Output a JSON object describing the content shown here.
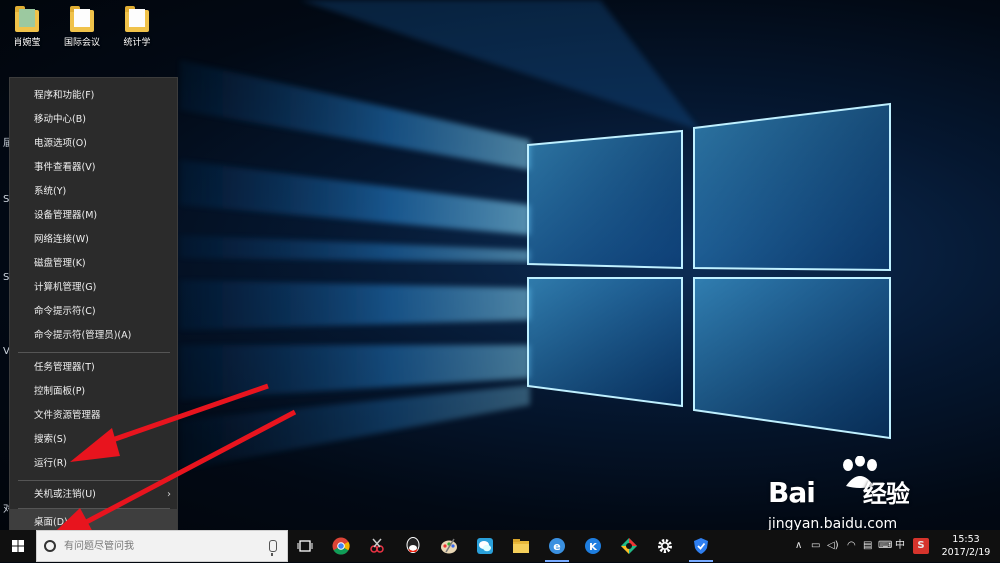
{
  "desktop": {
    "icons": [
      {
        "label": "肖婉莹",
        "kind": "user-folder"
      },
      {
        "label": "国际会议",
        "kind": "folder"
      },
      {
        "label": "统计学",
        "kind": "folder"
      }
    ],
    "edge_letters": [
      "届",
      "S",
      "S",
      "V",
      "对"
    ]
  },
  "winx_menu": {
    "items": [
      "程序和功能(F)",
      "移动中心(B)",
      "电源选项(O)",
      "事件查看器(V)",
      "系统(Y)",
      "设备管理器(M)",
      "网络连接(W)",
      "磁盘管理(K)",
      "计算机管理(G)",
      "命令提示符(C)",
      "命令提示符(管理员)(A)",
      "任务管理器(T)",
      "控制面板(P)",
      "文件资源管理器",
      "搜索(S)",
      "运行(R)",
      "关机或注销(U)",
      "桌面(D)"
    ],
    "highlighted_index": 17
  },
  "taskbar": {
    "search_placeholder": "有问题尽管问我",
    "apps": [
      {
        "icon": "task-view-icon"
      },
      {
        "icon": "chrome-icon"
      },
      {
        "icon": "snipping-icon"
      },
      {
        "icon": "qq-icon"
      },
      {
        "icon": "paint-icon"
      },
      {
        "icon": "wechat-icon"
      },
      {
        "icon": "file-explorer-icon"
      },
      {
        "icon": "ie-icon"
      },
      {
        "icon": "kugou-icon"
      },
      {
        "icon": "app-colorful-icon"
      },
      {
        "icon": "settings-icon"
      },
      {
        "icon": "security-shield-icon"
      }
    ],
    "tray": {
      "ime_label": "中",
      "time": "15:53",
      "date": "2017/2/19"
    }
  },
  "watermark": {
    "brand": "Bai",
    "brand_suffix": "经验",
    "url": "jingyan.baidu.com"
  },
  "colors": {
    "menu_bg": "#2b2b2b",
    "taskbar_bg": "#101010",
    "arrow": "#e8141e",
    "wallpaper_glow": "#3fb6ff"
  }
}
